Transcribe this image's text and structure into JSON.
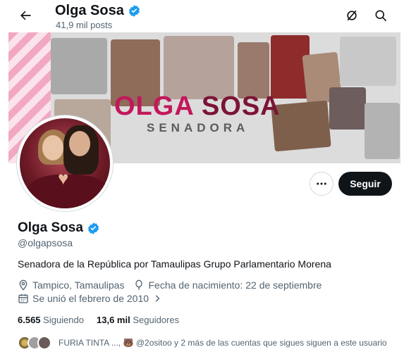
{
  "header": {
    "title": "Olga Sosa",
    "posts_count": "41,9 mil posts"
  },
  "banner": {
    "title_part1": "OLGA",
    "title_part2": "SOSA",
    "subtitle": "SENADORA"
  },
  "profile": {
    "name": "Olga Sosa",
    "handle": "@olgapsosa",
    "bio": "Senadora de la República por Tamaulipas Grupo Parlamentario Morena",
    "location": "Tampico, Tamaulipas",
    "birthday": "Fecha de nacimiento: 22 de septiembre",
    "joined": "Se unió el febrero de 2010"
  },
  "actions": {
    "follow_label": "Seguir"
  },
  "stats": {
    "following_count": "6.565",
    "following_label": "Siguiendo",
    "followers_count": "13,6 mil",
    "followers_label": "Seguidores"
  },
  "followers_you_know": {
    "text": "FURIA TINTA ..., 🐻 @2ositoo y 2 más de las cuentas que sigues siguen a este usuario"
  },
  "colors": {
    "verified": "#1d9bf0",
    "brand_pink": "#c2185b",
    "follow_bg": "#0f1419"
  }
}
